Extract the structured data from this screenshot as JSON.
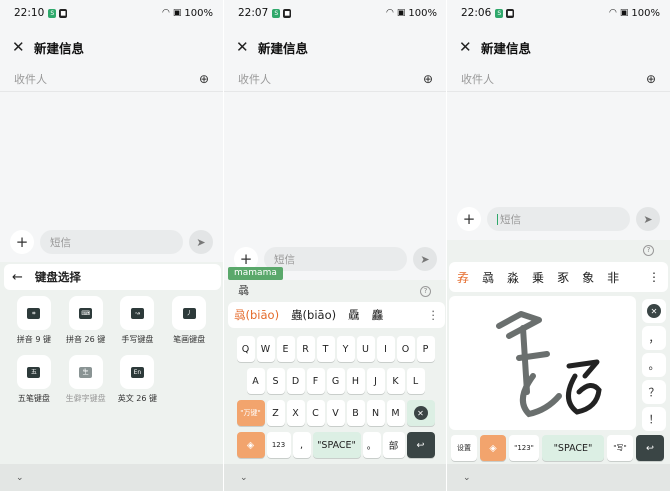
{
  "status": {
    "panel1_time": "22:10",
    "panel2_time": "22:07",
    "panel3_time": "22:06",
    "battery": "100%",
    "icons": [
      "wifi-icon",
      "sim-icon",
      "battery-icon"
    ]
  },
  "common": {
    "title": "新建信息",
    "recipient_placeholder": "收件人",
    "message_placeholder": "短信",
    "close_glyph": "✕",
    "plus_glyph": "+",
    "send_glyph": "➤",
    "add_contact_glyph": "⊕",
    "nav_glyph": "⌄"
  },
  "panel1": {
    "keyboard_select_title": "键盘选择",
    "back_glyph": "←",
    "keyboards": [
      {
        "label": "拼音 9 键",
        "icon": "⌗",
        "dim": false
      },
      {
        "label": "拼音 26 键",
        "icon": "⌨",
        "dim": false
      },
      {
        "label": "手写键盘",
        "icon": "↝",
        "dim": false
      },
      {
        "label": "笔画键盘",
        "icon": "丿",
        "dim": false
      },
      {
        "label": "五笔键盘",
        "icon": "五",
        "dim": false
      },
      {
        "label": "生僻字键盘",
        "icon": "生",
        "dim": true
      },
      {
        "label": "英文 26 键",
        "icon": "En",
        "dim": false
      }
    ]
  },
  "panel2": {
    "hint": "mamama",
    "composing": "骉",
    "help_glyph": "?",
    "candidates": [
      "骉(biāo)",
      "蟲(biāo)",
      "驫",
      "麤"
    ],
    "more_glyph": "⋮",
    "row1": [
      "Q",
      "W",
      "E",
      "R",
      "T",
      "Y",
      "U",
      "I",
      "O",
      "P"
    ],
    "row2": [
      "A",
      "S",
      "D",
      "F",
      "G",
      "H",
      "J",
      "K",
      "L"
    ],
    "row3": [
      "Z",
      "X",
      "C",
      "V",
      "B",
      "N",
      "M"
    ],
    "shift_label": "\"万键\"",
    "delete_glyph": "✕",
    "numeric_label": "123",
    "comma_label": ",",
    "space_label": "\"SPACE\"",
    "period_label": "。",
    "bushou_label": "部",
    "enter_glyph": "↩"
  },
  "panel3": {
    "candidates": [
      "孨",
      "骉",
      "淼",
      "乗",
      "豖",
      "象",
      "非"
    ],
    "more_glyph": "⋮",
    "help_glyph": "?",
    "punctuation": [
      "✕",
      "，",
      "。",
      "？",
      "！"
    ],
    "settings_label": "设置",
    "numeric_label": "\"123\"",
    "space_label": "\"SPACE\"",
    "write_label": "\"写\"",
    "enter_glyph": "↩"
  },
  "colors": {
    "accent_orange": "#f2a46d",
    "candidate_orange": "#e46a2a",
    "dark_key": "#3a4545",
    "mint_key": "#dcefe4",
    "hint_green": "#5aa86b"
  }
}
